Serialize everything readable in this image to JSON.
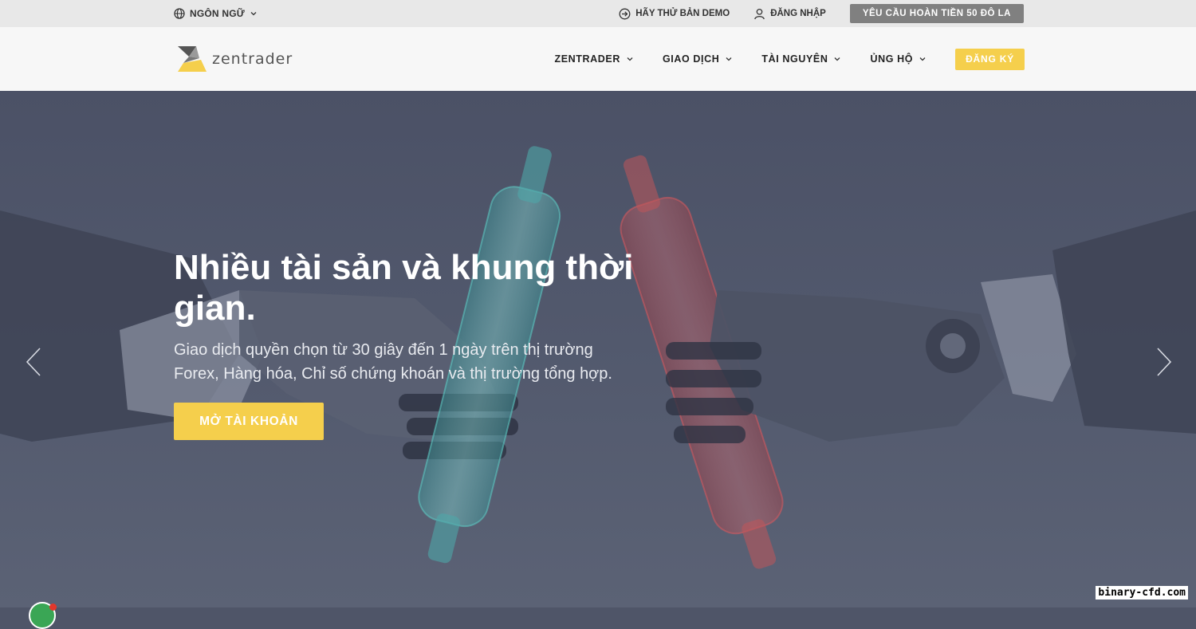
{
  "topbar": {
    "language_label": "NGÔN NGỮ",
    "demo_label": "HÃY THỬ BẢN DEMO",
    "login_label": "ĐĂNG NHẬP",
    "refund_label": "YÊU CẦU HOÀN TIỀN 50 ĐÔ LA"
  },
  "navbar": {
    "logo_text": "zentrader",
    "menu": [
      {
        "label": "ZENTRADER"
      },
      {
        "label": "GIAO DỊCH"
      },
      {
        "label": "TÀI NGUYÊN"
      },
      {
        "label": "ỦNG HỘ"
      }
    ],
    "signup_label": "ĐĂNG KÝ"
  },
  "hero": {
    "title": "Nhiều tài sản và khung thời gian.",
    "subtitle": "Giao dịch quyền chọn từ 30 giây đến 1 ngày trên thị trường Forex, Hàng hóa, Chỉ số chứng khoán và thị trường tổng hợp.",
    "cta_label": "MỞ TÀI KHOẢN"
  },
  "watermark": "binary-cfd.com",
  "colors": {
    "accent": "#f5cf4c",
    "topbar_bg": "#e8e8e8",
    "nav_bg": "#f7f7f7",
    "hero_bg": "#4f5568",
    "refund_bg": "#808080",
    "cylinder_teal": "#49b3ad",
    "cylinder_red": "#d9474c"
  },
  "icons": {
    "language": "globe-icon",
    "demo": "arrow-circle-icon",
    "login": "user-icon",
    "dropdown": "chevron-down-icon",
    "prev": "chevron-left-icon",
    "next": "chevron-right-icon"
  }
}
